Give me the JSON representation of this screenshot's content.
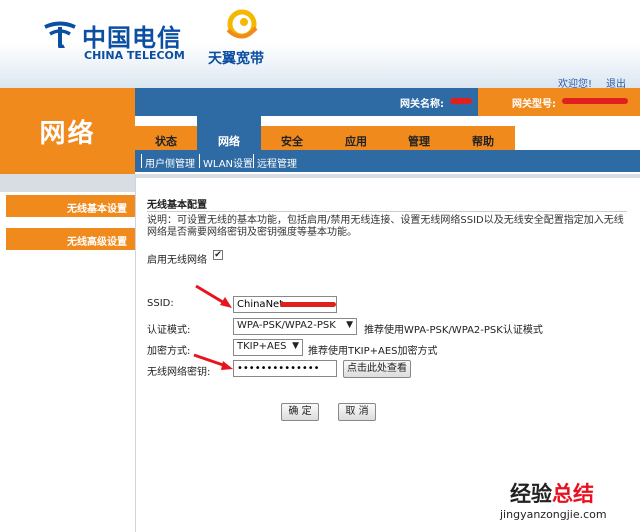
{
  "header": {
    "logo_cn": "中国电信",
    "logo_en": "CHINA TELECOM",
    "brand": "天翼宽带",
    "welcome": "欢迎您!",
    "logout": "退出"
  },
  "section": {
    "title": "网络"
  },
  "gateway": {
    "name_label": "网关名称:",
    "type_label": "网关型号:"
  },
  "tabs": [
    {
      "label": "状态"
    },
    {
      "label": "网络"
    },
    {
      "label": "安全"
    },
    {
      "label": "应用"
    },
    {
      "label": "管理"
    },
    {
      "label": "帮助"
    }
  ],
  "subnav": [
    {
      "label": "用户侧管理"
    },
    {
      "label": "WLAN设置"
    },
    {
      "label": "远程管理"
    }
  ],
  "left_menu": [
    {
      "label": "无线基本设置"
    },
    {
      "label": "无线高级设置"
    }
  ],
  "form": {
    "title": "无线基本配置",
    "description": "说明：可设置无线的基本功能，包括启用/禁用无线连接、设置无线网络SSID以及无线安全配置指定加入无线网络是否需要网络密钥及密钥强度等基本功能。",
    "enable_label": "启用无线网络",
    "enable_checked": "✔",
    "ssid_label": "SSID:",
    "ssid_value": "ChinaNet-",
    "auth_label": "认证模式:",
    "auth_value": "WPA-PSK/WPA2-PSK",
    "auth_hint": "推荐使用WPA-PSK/WPA2-PSK认证模式",
    "enc_label": "加密方式:",
    "enc_value": "TKIP+AES",
    "enc_hint": "推荐使用TKIP+AES加密方式",
    "key_label": "无线网络密钥:",
    "key_value": "••••••••••••••",
    "show_key_button": "点击此处查看",
    "ok_button": "确 定",
    "cancel_button": "取 消"
  },
  "watermark": {
    "text_a": "经验",
    "text_b": "总结",
    "url": "jingyanzongjie.com"
  },
  "colors": {
    "orange": "#f08a1d",
    "blue": "#2e6aa4",
    "annotation_red": "#e8141e"
  }
}
